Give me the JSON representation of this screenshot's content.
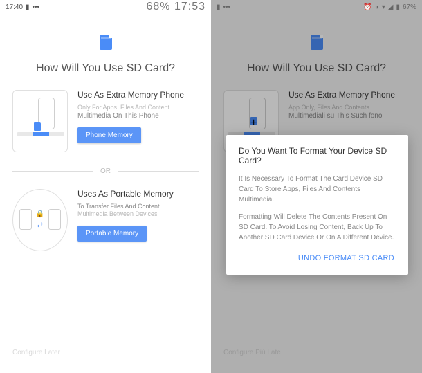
{
  "status": {
    "left_time": "17:40",
    "center": "68% 17:53",
    "right_battery": "67%"
  },
  "headline": "How Will You Use SD Card?",
  "option1": {
    "title": "Use As Extra Memory Phone",
    "sub1": "Only For Apps, Files And Content",
    "sub2": "Multimedia On This Phone",
    "button": "Phone Memory"
  },
  "or_label": "OR",
  "option2": {
    "title": "Uses As Portable Memory",
    "sub1": "To Transfer Files And Content",
    "sub2": "Multimedia Between Devices",
    "button": "Portable Memory"
  },
  "footer": "Configure Later",
  "right_side": {
    "opt1_sub1": "App Only, Files And Contents",
    "opt1_sub2": "Multimediali su This Such fono",
    "footer": "Configure Più Late"
  },
  "dialog": {
    "title": "Do You Want To Format Your Device SD Card?",
    "body1": "It Is Necessary To Format The Card Device SD Card To Store Apps, Files And Contents Multimedia.",
    "body2": "Formatting Will Delete The Contents Present On SD Card. To Avoid Losing Content, Back Up To Another SD Card Device Or On A Different Device.",
    "action": "UNDO FORMAT SD CARD"
  }
}
